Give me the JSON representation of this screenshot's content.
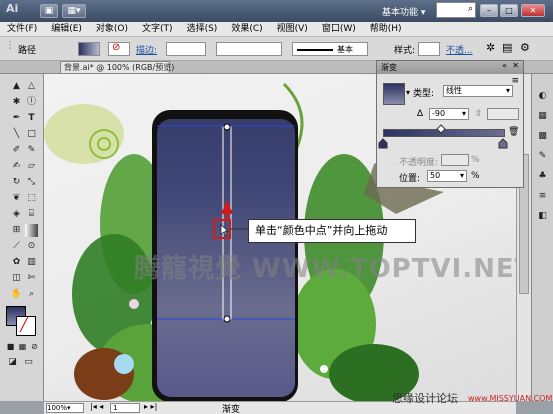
{
  "app": {
    "logo": "Ai",
    "workspace": "基本功能"
  },
  "menu": [
    "文件(F)",
    "编辑(E)",
    "对象(O)",
    "文字(T)",
    "选择(S)",
    "效果(C)",
    "视图(V)",
    "窗口(W)",
    "帮助(H)"
  ],
  "control_bar": {
    "path_label": "路径",
    "stroke_label": "描边:",
    "basic_label": "基本",
    "style_label": "样式:",
    "opacity_label": "不透..."
  },
  "document_tab": "背景.ai* @ 100% (RGB/预览)",
  "status_bar": {
    "zoom": "100%",
    "page": "1",
    "tool_name": "渐变"
  },
  "gradient_panel": {
    "title": "渐变",
    "type_label": "类型:",
    "type_value": "线性",
    "angle_value": "-90",
    "opacity_label": "不透明度:",
    "location_label": "位置:",
    "location_value": "50",
    "percent": "%"
  },
  "callout": "单击“颜色中点”并向上拖动",
  "watermark": "腾龍視覺 WWW.TOPTVI.NET",
  "footer": {
    "site_name": "思缘设计论坛",
    "site_url": "www.MISSYUAN.COM"
  },
  "colors": {
    "gradient_start": "#383e6b",
    "gradient_end": "#6a6c8f",
    "arrow": "#d11a1a"
  }
}
